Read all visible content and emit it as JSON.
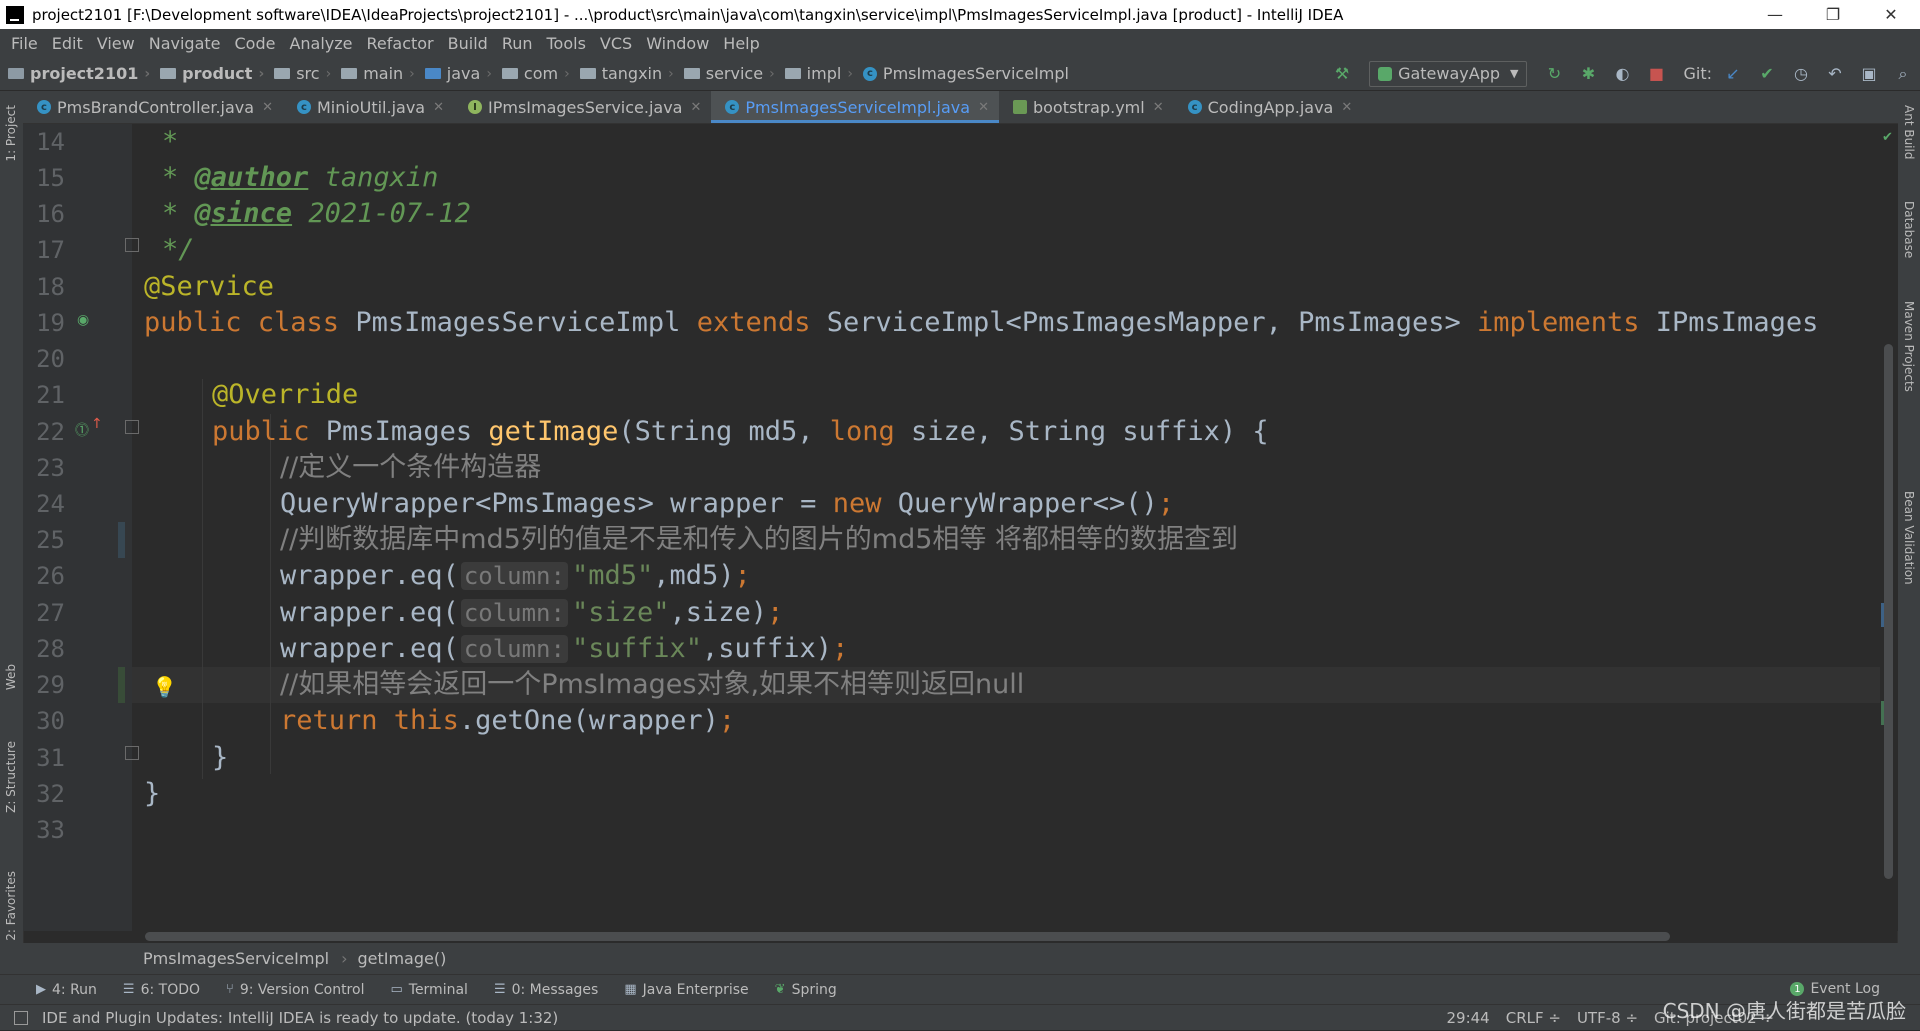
{
  "window": {
    "title": "project2101 [F:\\Development software\\IDEA\\IdeaProjects\\project2101] - ...\\product\\src\\main\\java\\com\\tangxin\\service\\impl\\PmsImagesServiceImpl.java [product] - IntelliJ IDEA",
    "minimize": "—",
    "restore": "❐",
    "close": "✕"
  },
  "menu": [
    "File",
    "Edit",
    "View",
    "Navigate",
    "Code",
    "Analyze",
    "Refactor",
    "Build",
    "Run",
    "Tools",
    "VCS",
    "Window",
    "Help"
  ],
  "breadcrumbs": [
    "project2101",
    "product",
    "src",
    "main",
    "java",
    "com",
    "tangxin",
    "service",
    "impl",
    "PmsImagesServiceImpl"
  ],
  "toolbar": {
    "run_config": "GatewayApp",
    "git_label": "Git:"
  },
  "tabs": [
    {
      "label": "PmsBrandController.java",
      "icon": "class-icon",
      "active": false
    },
    {
      "label": "MinioUtil.java",
      "icon": "class-icon",
      "active": false
    },
    {
      "label": "IPmsImagesService.java",
      "icon": "interface-icon",
      "active": false
    },
    {
      "label": "PmsImagesServiceImpl.java",
      "icon": "class-icon",
      "active": true
    },
    {
      "label": "bootstrap.yml",
      "icon": "yaml-icon",
      "active": false
    },
    {
      "label": "CodingApp.java",
      "icon": "class-icon",
      "active": false
    }
  ],
  "left_tool_tabs": [
    "1: Project",
    "Web",
    "Z: Structure",
    "2: Favorites"
  ],
  "right_tool_tabs": [
    "Ant Build",
    "Database",
    "Maven Projects",
    "Bean Validation"
  ],
  "editor": {
    "line_numbers": [
      "14",
      "15",
      "16",
      "17",
      "18",
      "19",
      "20",
      "21",
      "22",
      "23",
      "24",
      "25",
      "26",
      "27",
      "28",
      "29",
      "30",
      "31",
      "32",
      "33"
    ],
    "caret_line": "29",
    "code": {
      "l14": "*",
      "l15_star": "* ",
      "l15_tag": "@author",
      "l15_text": " tangxin",
      "l16_star": "* ",
      "l16_tag": "@since",
      "l16_text": " 2021-07-12",
      "l17": "*/",
      "l18": "@Service",
      "l19_kw": "public class ",
      "l19_name": "PmsImagesServiceImpl ",
      "l19_ext": "extends ",
      "l19_super": "ServiceImpl<PmsImagesMapper, PmsImages> ",
      "l19_impl": "implements ",
      "l19_iface": "IPmsImages",
      "l21": "@Override",
      "l22_kw": "public ",
      "l22_type": "PmsImages ",
      "l22_fn": "getImage",
      "l22_p1": "(String md5, ",
      "l22_long": "long ",
      "l22_p2": "size, String suffix) {",
      "l23": "//定义一个条件构造器",
      "l24_a": "QueryWrapper<PmsImages> wrapper = ",
      "l24_new": "new ",
      "l24_b": "QueryWrapper<>()",
      "l24_semi": ";",
      "l25": "//判断数据库中md5列的值是不是和传入的图片的md5相等 将都相等的数据查到",
      "l26_a": "wrapper.eq(",
      "hint_column": "column:",
      "l26_str": "\"md5\"",
      "l26_b": ",md5)",
      "l27_a": "wrapper.eq(",
      "l27_str": "\"size\"",
      "l27_b": ",size)",
      "l28_a": "wrapper.eq(",
      "l28_str": "\"suffix\"",
      "l28_b": ",suffix)",
      "semi": ";",
      "l29": "//如果相等会返回一个PmsImages对象,如果不相等则返回null",
      "l30_ret": "return ",
      "l30_this": "this",
      "l30_b": ".getOne(wrapper)",
      "l31": "}",
      "l32": "}"
    }
  },
  "code_breadcrumbs": [
    "PmsImagesServiceImpl",
    "getImage()"
  ],
  "tool_windows": [
    "4: Run",
    "6: TODO",
    "9: Version Control",
    "Terminal",
    "0: Messages",
    "Java Enterprise",
    "Spring"
  ],
  "event_log": "Event Log",
  "status": {
    "message": "IDE and Plugin Updates: IntelliJ IDEA is ready to update. (today 1:32)",
    "position": "29:44",
    "line_sep": "CRLF ÷",
    "encoding": "UTF-8 ÷",
    "git": "Git: project02 ÷"
  },
  "watermark": "CSDN @唐人街都是苦瓜脸",
  "colors": {
    "keyword": "#cc7832",
    "annotation": "#bbb529",
    "function": "#ffc66d",
    "string": "#6a8759",
    "comment": "#808080",
    "doc": "#629755",
    "text": "#a9b7c6",
    "active_tab": "#589df6"
  }
}
